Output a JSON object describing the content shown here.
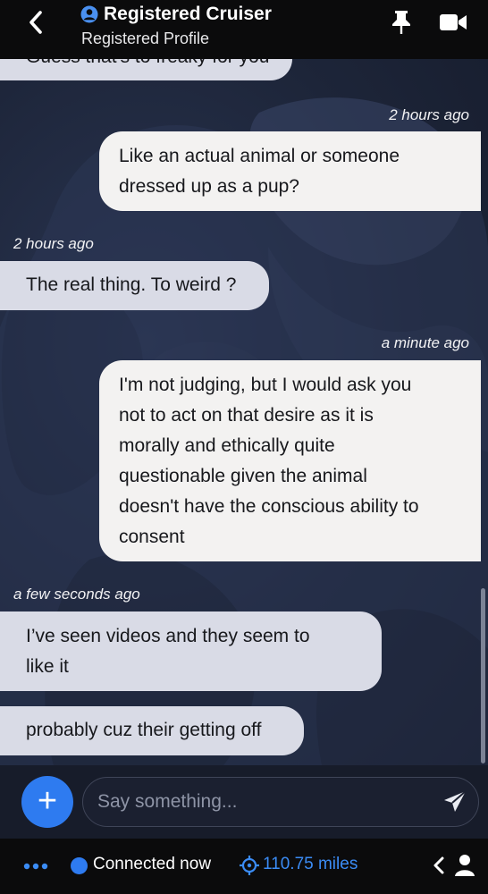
{
  "header": {
    "title": "Registered Cruiser",
    "subtitle": "Registered Profile",
    "icons": [
      "back-chevron-icon",
      "user-circle-icon",
      "pin-icon",
      "video-camera-icon"
    ]
  },
  "messages": [
    {
      "side": "left",
      "lines": [
        "Guess that's to freaky for you"
      ]
    },
    {
      "side": "right",
      "timestamp": "2 hours ago",
      "lines": [
        "Like an actual animal or someone",
        "dressed up as a pup?"
      ]
    },
    {
      "side": "left",
      "timestamp": "2 hours ago",
      "lines": [
        "The real thing. To weird ?"
      ]
    },
    {
      "side": "right",
      "timestamp": "a minute ago",
      "lines": [
        "I'm not judging, but I would ask you",
        "not to act on that desire as it is",
        "morally and ethically quite",
        "questionable given the animal",
        "doesn't have the conscious ability to",
        "consent"
      ]
    },
    {
      "side": "left",
      "timestamp": "a few seconds ago",
      "lines": [
        "I’ve seen videos and they seem to",
        "like it"
      ]
    },
    {
      "side": "left",
      "lines": [
        "probably cuz their getting off"
      ]
    }
  ],
  "composer": {
    "add_icon": "+",
    "placeholder": "Say something...",
    "send_icon": "paper-plane-icon"
  },
  "status": {
    "connection": "Connected now",
    "distance": "110.75 miles",
    "accent_color": "#2e7bf0",
    "icons": [
      "more-dots-icon",
      "online-dot-icon",
      "crosshair-icon",
      "chevron-left-icon",
      "profile-icon"
    ]
  },
  "colors": {
    "header_bg": "#0b0b0c",
    "chat_bg": "#1d2539",
    "incoming_bubble": "#d9dbe6",
    "outgoing_bubble": "#f3f2f1"
  }
}
